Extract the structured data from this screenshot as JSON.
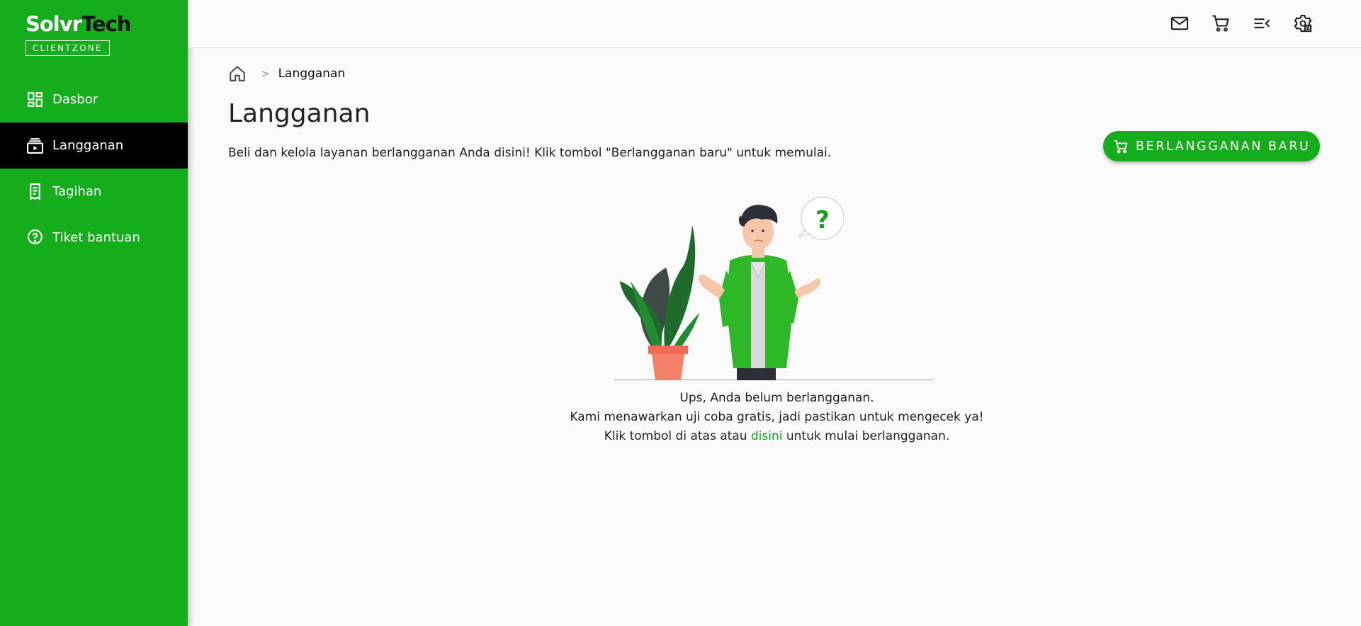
{
  "brand": {
    "name_part1": "Solvr",
    "name_part2": "Tech",
    "subtitle": "CLIENTZONE"
  },
  "sidebar": {
    "items": [
      {
        "label": "Dasbor",
        "icon": "dashboard-icon",
        "active": false
      },
      {
        "label": "Langganan",
        "icon": "subscriptions-icon",
        "active": true
      },
      {
        "label": "Tagihan",
        "icon": "receipt-icon",
        "active": false
      },
      {
        "label": "Tiket bantuan",
        "icon": "help-icon",
        "active": false
      }
    ]
  },
  "topbar": {
    "icons": [
      "mail-icon",
      "cart-icon",
      "menu-collapse-icon",
      "settings-icon"
    ]
  },
  "breadcrumb": {
    "separator": ">",
    "current": "Langganan"
  },
  "page": {
    "title": "Langganan",
    "description": "Beli dan kelola layanan berlangganan Anda disini! Klik tombol \"Berlangganan baru\" untuk memulai.",
    "new_button_label": "BERLANGGANAN BARU"
  },
  "empty_state": {
    "line1": "Ups, Anda belum berlangganan.",
    "line2": "Kami menawarkan uji coba gratis, jadi pastikan untuk mengecek ya!",
    "line3_prefix": "Klik tombol di atas atau ",
    "line3_link": "disini",
    "line3_suffix": " untuk mulai berlangganan."
  },
  "colors": {
    "accent": "#15ad1c",
    "active_nav": "#000000",
    "link": "#15a01c"
  }
}
